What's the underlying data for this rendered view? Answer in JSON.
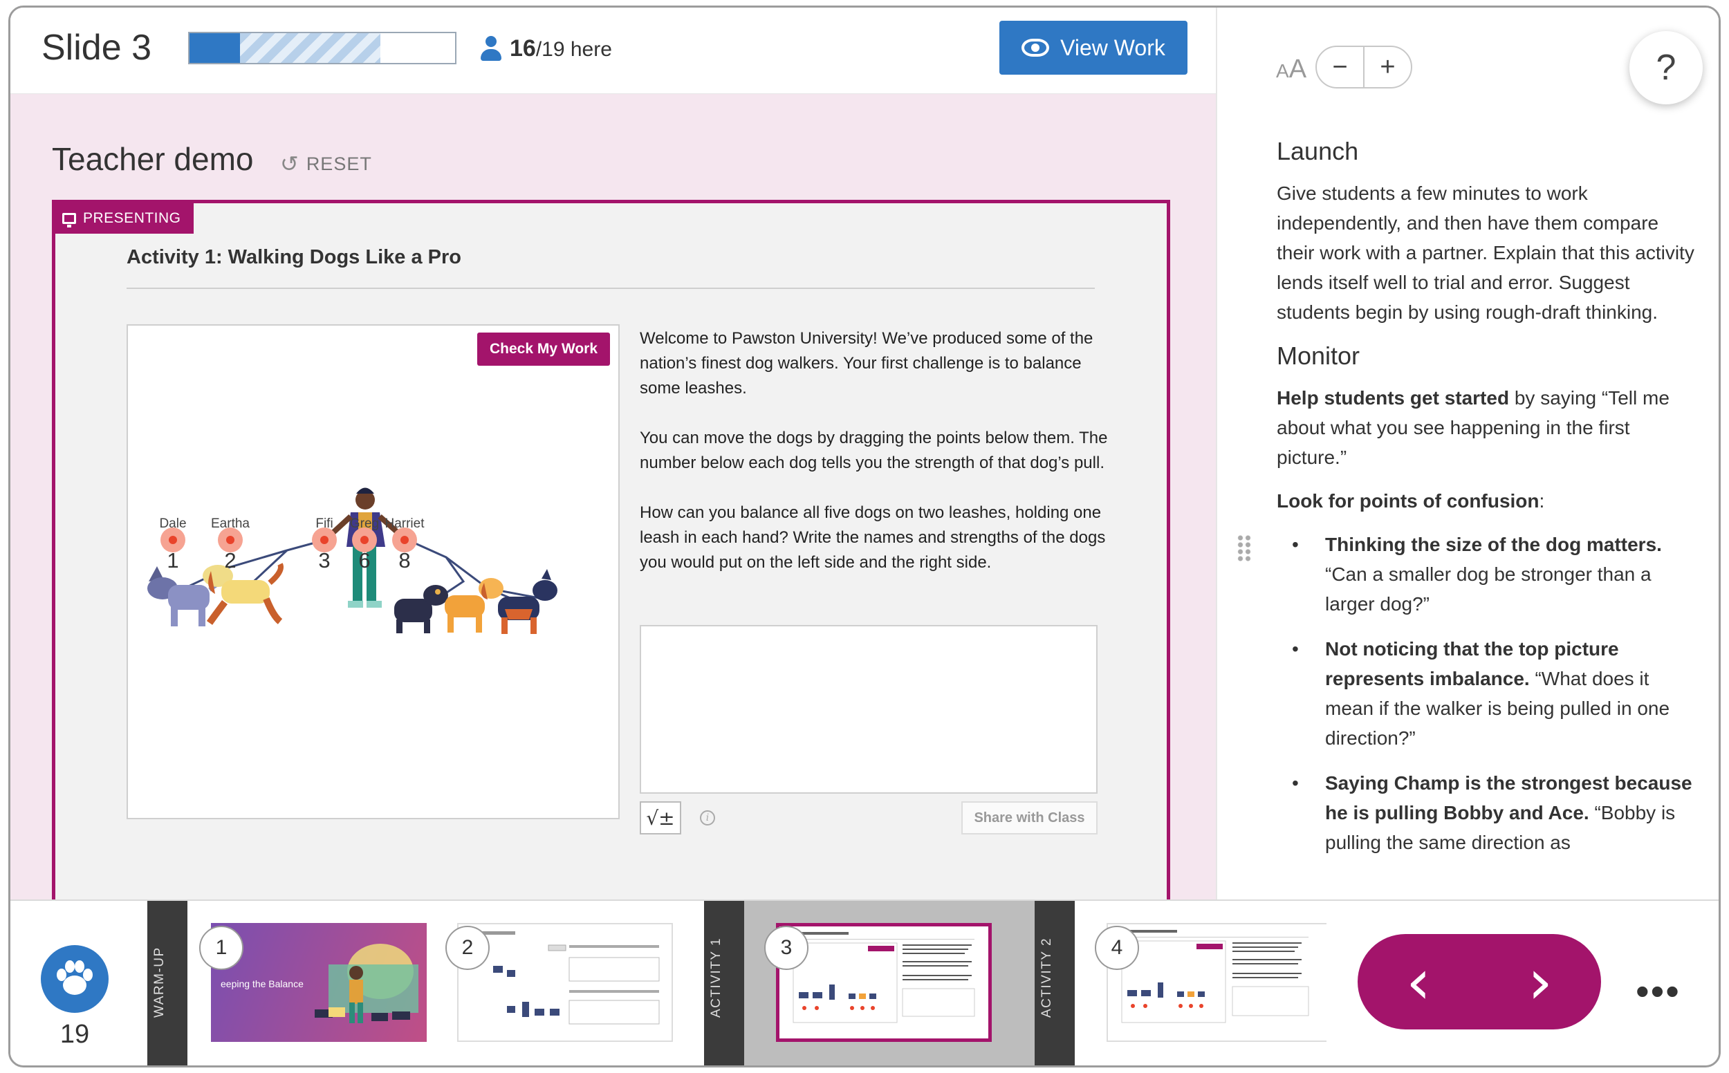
{
  "header": {
    "slide_title": "Slide 3",
    "progress": {
      "completed": 0.19,
      "partial": 0.53
    },
    "attendance_present": "16",
    "attendance_total": "/19 here",
    "view_work_label": "View Work"
  },
  "demo": {
    "title": "Teacher demo",
    "reset_label": "RESET"
  },
  "activity": {
    "presenting_label": "PRESENTING",
    "title": "Activity 1: Walking Dogs Like a Pro",
    "check_button": "Check My Work",
    "dogs": [
      {
        "name": "Dale",
        "strength": "1"
      },
      {
        "name": "Eartha",
        "strength": "2"
      },
      {
        "name": "Fifi",
        "strength": "3"
      },
      {
        "name": "Greg",
        "strength": "6"
      },
      {
        "name": "Harriet",
        "strength": "8"
      }
    ],
    "paragraphs": [
      "Welcome to Pawston University! We’ve produced some of the nation’s finest dog walkers. Your first challenge is to balance some leashes.",
      "You can move the dogs by dragging the points below them. The number below each dog tells you the strength of that dog’s pull.",
      "How can you balance all five dogs on two leashes, holding one leash in each hand? Write the names and strengths of the dogs you would put on the left side and the right side."
    ],
    "math_button": "√±",
    "info_icon": "i",
    "share_button": "Share with Class"
  },
  "notes": {
    "font_size_label_small": "A",
    "font_size_label_large": "A",
    "zoom_out": "−",
    "zoom_in": "+",
    "help": "?",
    "launch_heading": "Launch",
    "launch_text": "Give students a few minutes to work independently, and then have them compare their work with a partner. Explain that this activity lends itself well to trial and error. Suggest students begin by using rough-draft thinking.",
    "monitor_heading": "Monitor",
    "help_start_bold": "Help students get started",
    "help_start_text": " by saying “Tell me about what you see happening in the first picture.”",
    "confusion_bold": "Look for points of confusion",
    "confusion_colon": ":",
    "bullets": [
      {
        "bold": "Thinking the size of the dog matters.",
        "text": " “Can a smaller dog be stronger than a larger dog?”"
      },
      {
        "bold": "Not noticing that the top picture represents imbalance.",
        "text": " “What does it mean if the walker is being pulled in one direction?”"
      },
      {
        "bold": "Saying Champ is the strongest because he is pulling Bobby and Ace.",
        "text": " “Bobby is pulling the same direction as"
      }
    ]
  },
  "filmstrip": {
    "student_count": "19",
    "sections": [
      "WARM-UP",
      "ACTIVITY 1",
      "ACTIVITY 2"
    ],
    "slides": [
      {
        "number": "1",
        "caption": "eeping the Balance"
      },
      {
        "number": "2"
      },
      {
        "number": "3"
      },
      {
        "number": "4"
      }
    ],
    "prev_label": "‹",
    "next_label": "›",
    "more_label": "•••"
  },
  "colors": {
    "brand_magenta": "#a3146b",
    "primary_blue": "#2f78c4",
    "presentation_bg": "#f5e6ef"
  }
}
